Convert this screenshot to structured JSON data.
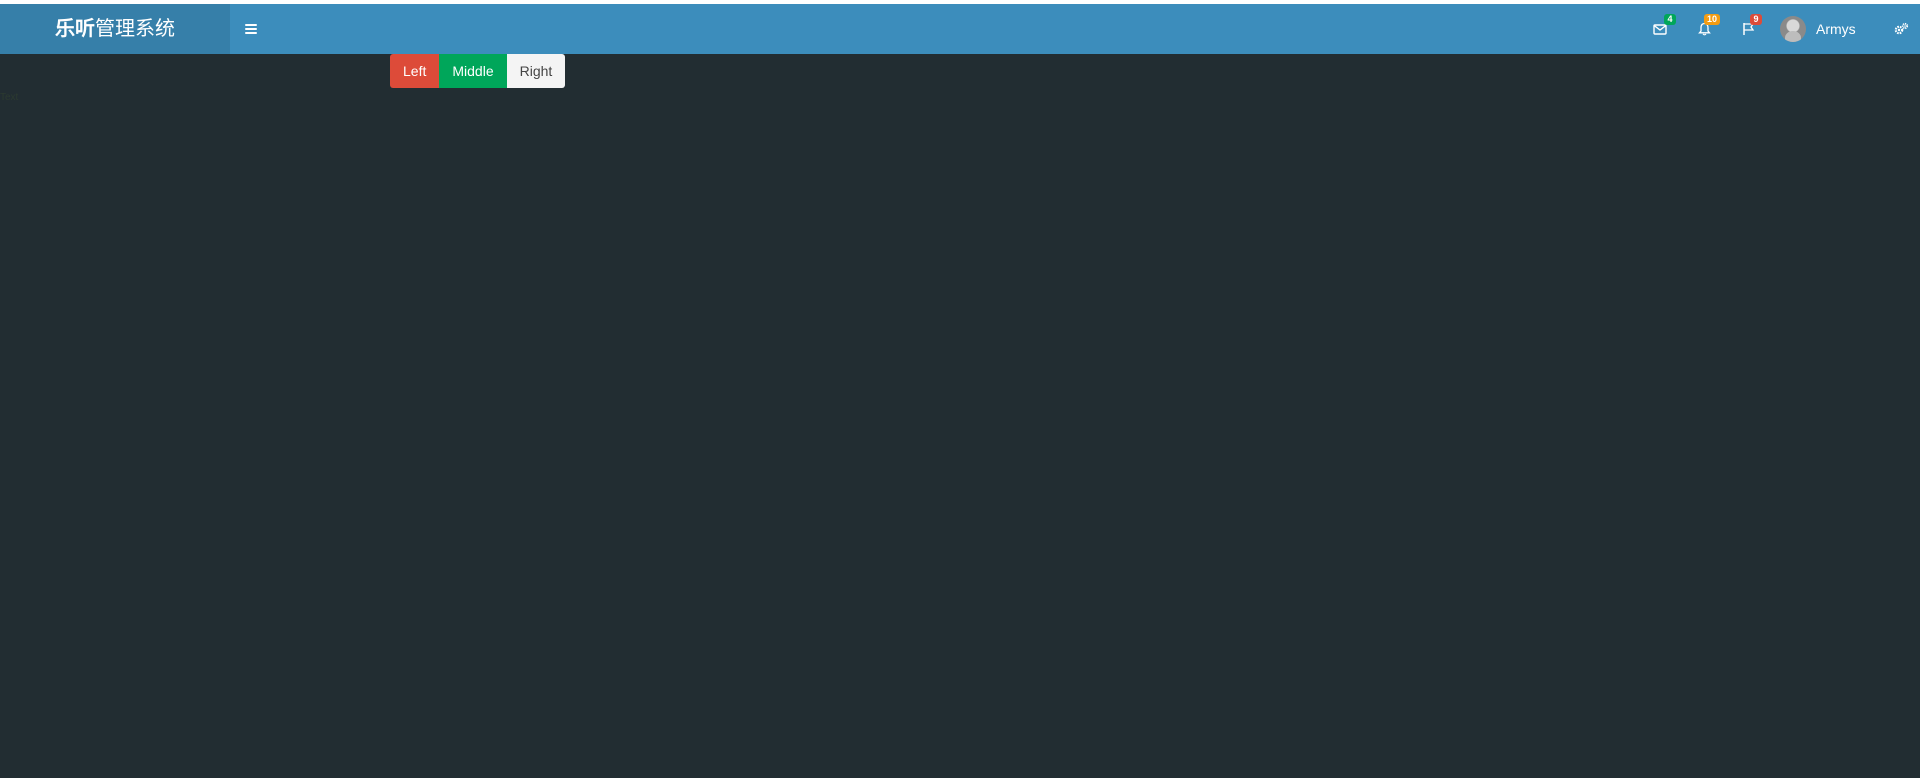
{
  "header": {
    "logo_bold": "乐听",
    "logo_light": "管理系统",
    "messages_badge": "4",
    "notifications_badge": "10",
    "tasks_badge": "9",
    "username": "Armys"
  },
  "buttons": {
    "left": "Left",
    "middle": "Middle",
    "right": "Right"
  },
  "faint_text": "Text",
  "colors": {
    "header_bg": "#3c8dbc",
    "logo_bg": "#367fa9",
    "page_bg": "#222d32",
    "badge_success": "#00a65a",
    "badge_warning": "#f39c12",
    "badge_danger": "#dd4b39",
    "btn_left": "#dd4b39",
    "btn_middle": "#00a65a",
    "btn_right": "#f4f4f4"
  },
  "icons": {
    "menu": "hamburger-icon",
    "messages": "envelope-icon",
    "notifications": "bell-icon",
    "tasks": "flag-icon",
    "settings": "gears-icon"
  }
}
